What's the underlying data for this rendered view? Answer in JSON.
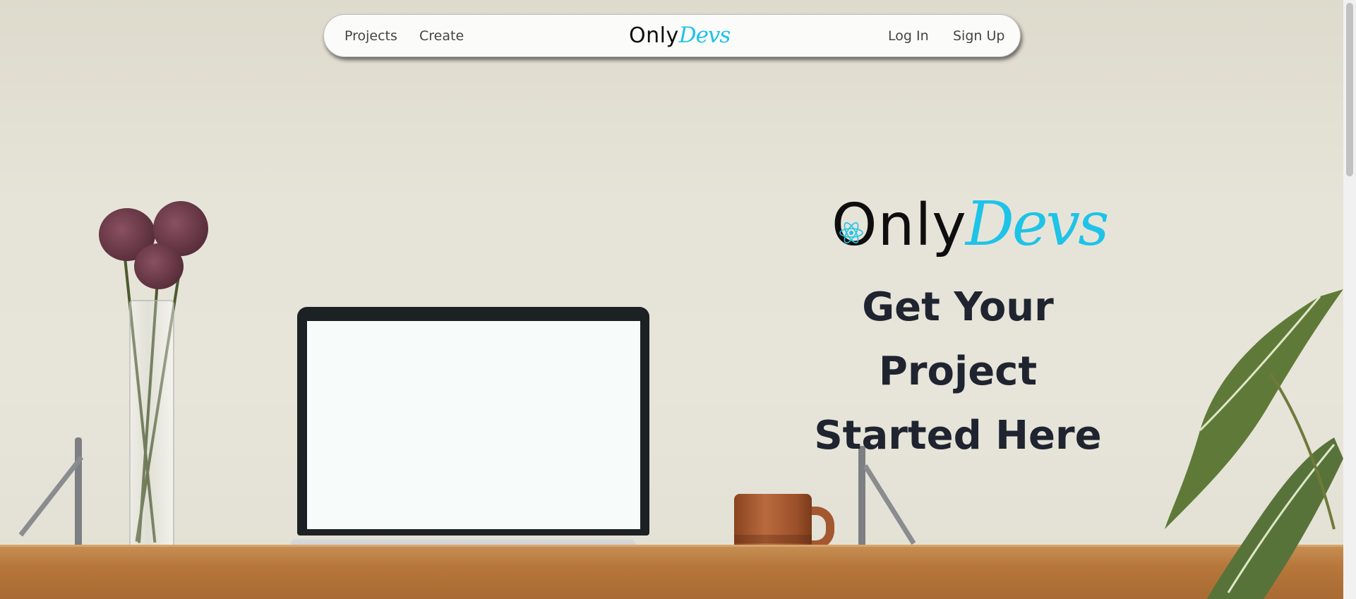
{
  "nav": {
    "links_left": [
      "Projects",
      "Create"
    ],
    "logo": {
      "only": "Only",
      "devs": "Devs"
    },
    "links_right": [
      "Log In",
      "Sign Up"
    ]
  },
  "hero": {
    "logo": {
      "only": "Only",
      "devs": "Devs"
    },
    "heading_line1": "Get Your Project",
    "heading_line2": "Started Here"
  },
  "colors": {
    "accent": "#1ec3e8",
    "heading": "#1f2430",
    "nav_bg": "#fbfbfa"
  },
  "icons": [
    "react-atom-icon"
  ]
}
